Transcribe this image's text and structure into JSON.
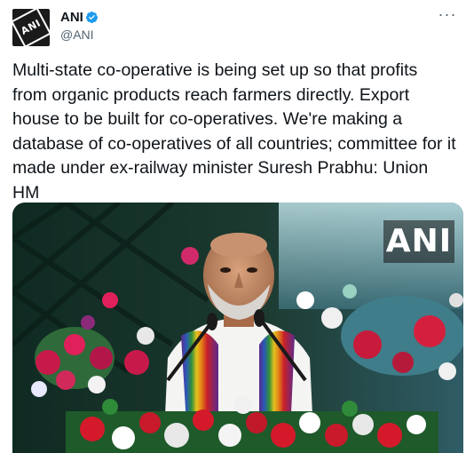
{
  "author": {
    "name": "ANI",
    "handle": "@ANI",
    "avatar_text": "ANI",
    "verified": true
  },
  "tweet": {
    "text": "Multi-state co-operative is being set up so that profits from organic products reach farmers directly. Export house to be built for co-operatives. We're making a database of co-operatives of all countries; committee for it made under ex-railway minister Suresh Prabhu: Union HM"
  },
  "media": {
    "watermark": "ANI"
  },
  "icons": {
    "verified": "verified-badge-icon",
    "more": "more-options-icon"
  },
  "colors": {
    "verified_badge": "#1d9bf0",
    "handle": "#536471",
    "text": "#0f1419"
  }
}
